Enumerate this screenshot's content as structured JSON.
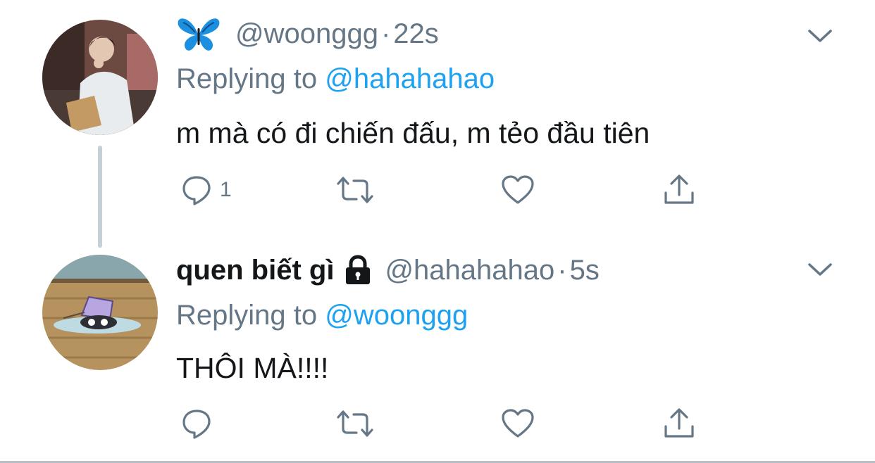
{
  "tweets": [
    {
      "display_name": "",
      "name_icon": "butterfly-emoji",
      "handle": "@woonggg",
      "separator": "·",
      "time": "22s",
      "replying_label": "Replying to",
      "replying_to": "@hahahahao",
      "text": "m mà có đi chiến đấu, m tẻo đầu tiên",
      "reply_count": "1",
      "avatar": "user-photo-avatar"
    },
    {
      "display_name": "quen biết gì",
      "name_icon": "lock-icon",
      "handle": "@hahahahao",
      "separator": "·",
      "time": "5s",
      "replying_label": "Replying to",
      "replying_to": "@woonggg",
      "text": "THÔI MÀ!!!!",
      "reply_count": "",
      "avatar": "cartoon-avatar"
    }
  ],
  "colors": {
    "link": "#1da1f2",
    "secondary_text": "#657786",
    "primary_text": "#14171a",
    "thread_line": "#c4cfd6",
    "icon": "#657786"
  }
}
